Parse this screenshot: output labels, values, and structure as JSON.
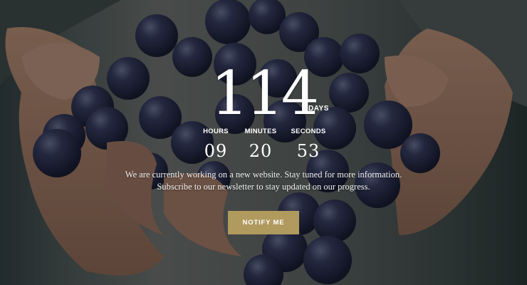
{
  "countdown": {
    "days": "114",
    "days_label": "DAYS",
    "hours_label": "HOURS",
    "hours": "09",
    "minutes_label": "MINUTES",
    "minutes": "20",
    "seconds_label": "SECONDS",
    "seconds": "53"
  },
  "message": {
    "line1": "We are currently working on a new website. Stay tuned for more information.",
    "line2": "Subscribe to our newsletter to stay updated on our progress."
  },
  "cta": {
    "label": "NOTIFY ME"
  },
  "colors": {
    "accent": "#b09a5e",
    "text": "#ffffff",
    "grape": "#2a2e45",
    "skin": "#a07a63"
  }
}
